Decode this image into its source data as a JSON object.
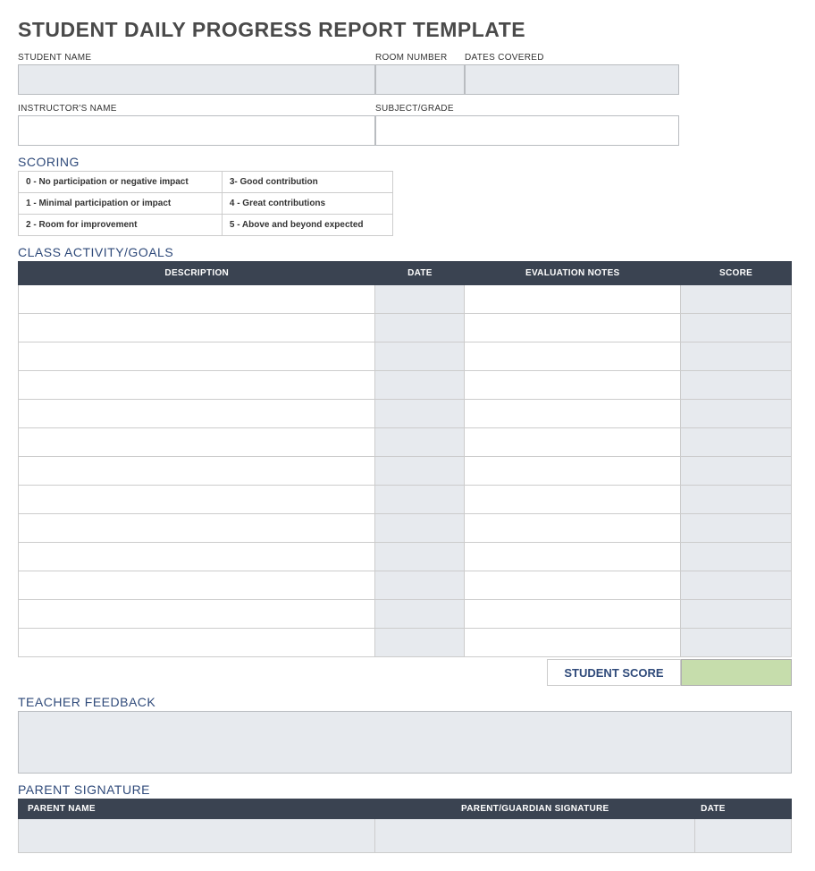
{
  "title": "STUDENT DAILY PROGRESS REPORT TEMPLATE",
  "fields": {
    "student_name": "STUDENT NAME",
    "room_number": "ROOM NUMBER",
    "dates_covered": "DATES COVERED",
    "instructors_name": "INSTRUCTOR'S NAME",
    "subject_grade": "SUBJECT/GRADE"
  },
  "sections": {
    "scoring": "SCORING",
    "activity": "CLASS ACTIVITY/GOALS",
    "feedback": "TEACHER FEEDBACK",
    "parent": "PARENT SIGNATURE"
  },
  "scoring": {
    "rows": [
      {
        "left": "0 - No participation or negative impact",
        "right": "3- Good contribution"
      },
      {
        "left": "1 - Minimal participation or impact",
        "right": "4 - Great contributions"
      },
      {
        "left": "2 - Room for improvement",
        "right": "5 - Above and beyond expected"
      }
    ]
  },
  "activity_headers": {
    "description": "DESCRIPTION",
    "date": "DATE",
    "evaluation": "EVALUATION NOTES",
    "score": "SCORE"
  },
  "student_score_label": "STUDENT SCORE",
  "parent_headers": {
    "name": "PARENT NAME",
    "signature": "PARENT/GUARDIAN SIGNATURE",
    "date": "DATE"
  }
}
